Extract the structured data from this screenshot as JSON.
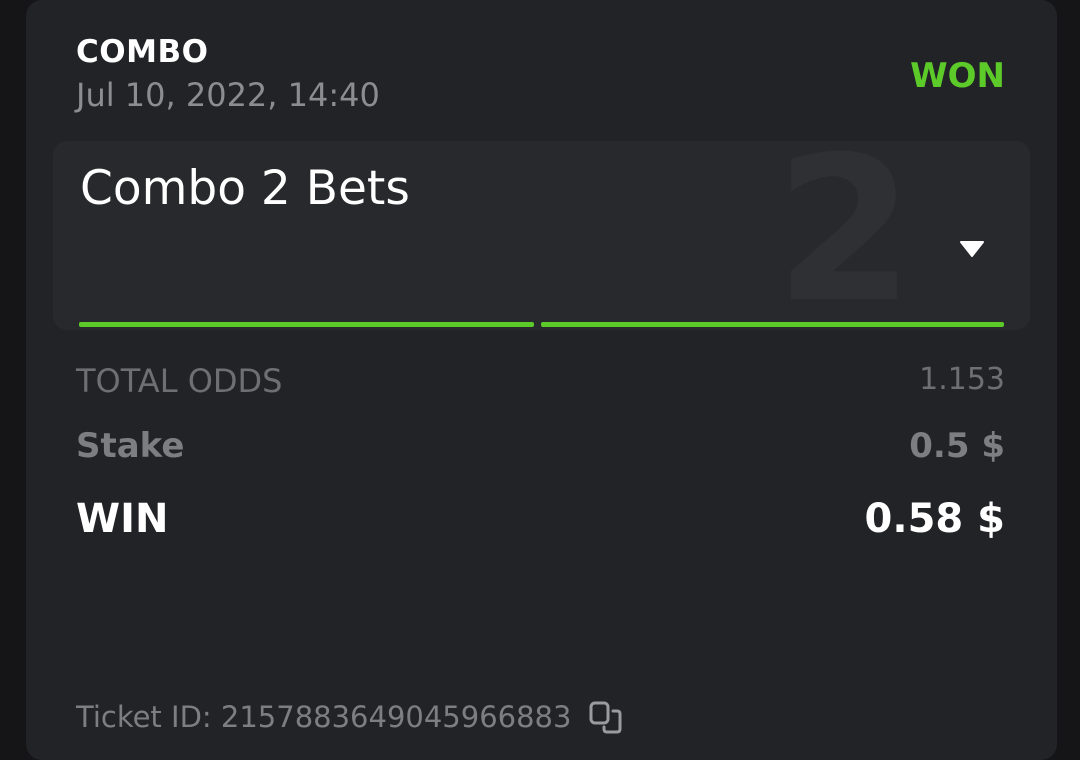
{
  "bet": {
    "type_label": "COMBO",
    "date": "Jul 10, 2022, 14:40",
    "status": "WON",
    "combo_title": "Combo 2 Bets",
    "combo_number": "2",
    "total_odds_label": "TOTAL ODDS",
    "total_odds_value": "1.153",
    "stake_label": "Stake",
    "stake_value": "0.5 $",
    "win_label": "WIN",
    "win_value": "0.58 $",
    "ticket_id": "Ticket ID: 2157883649045966883"
  },
  "colors": {
    "accent_green": "#5ccb2a",
    "card_bg": "#222326",
    "page_bg": "#151518"
  },
  "icons": {
    "dropdown": "chevron-down-icon",
    "copy": "copy-icon"
  }
}
